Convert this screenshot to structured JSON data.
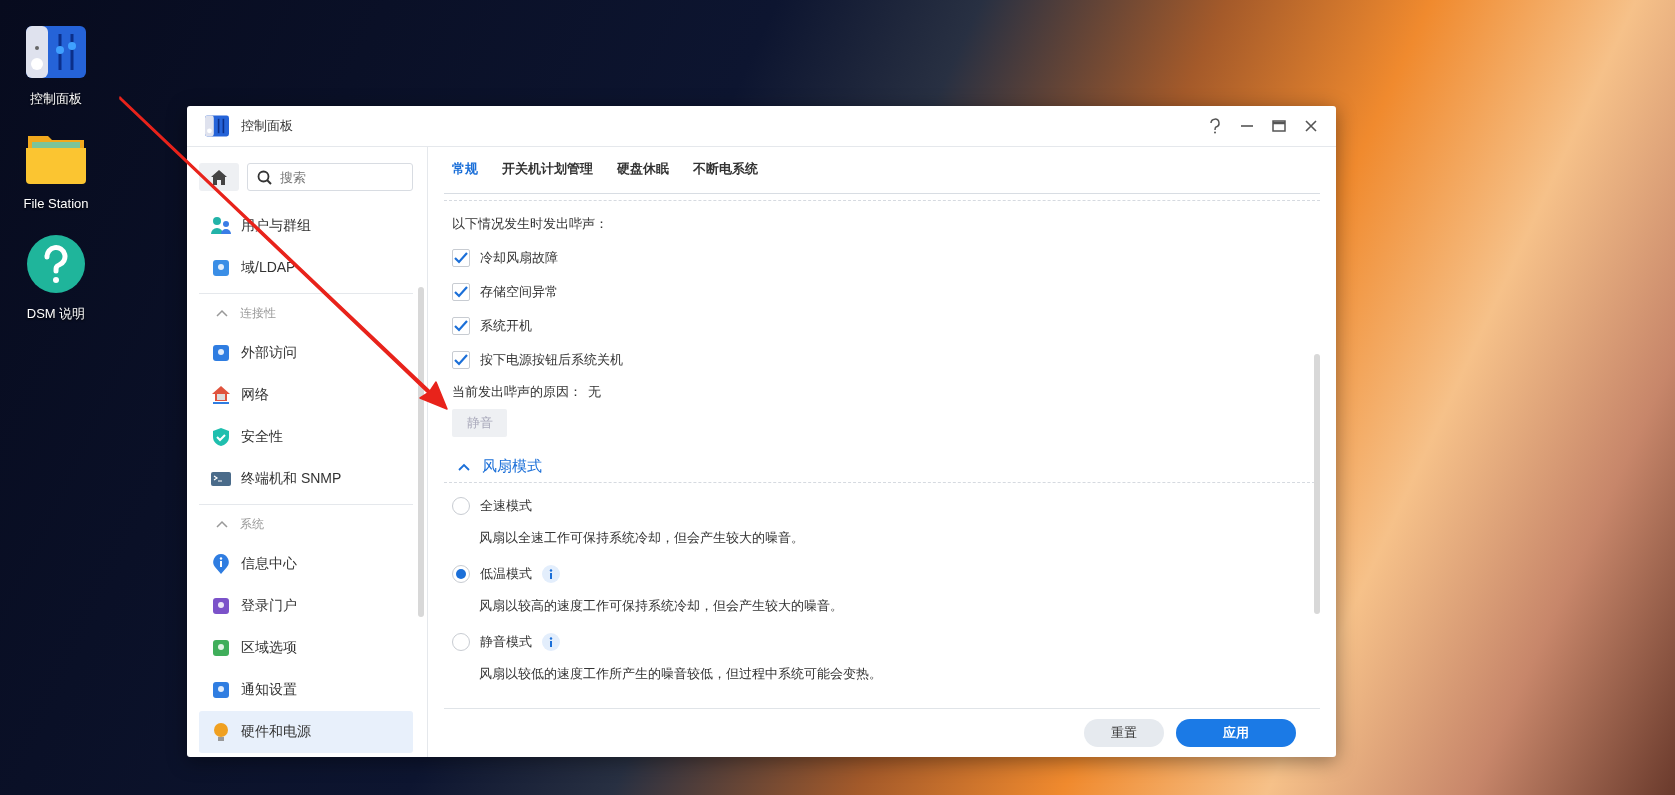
{
  "desktop_icons": [
    {
      "label": "控制面板",
      "kind": "control-panel"
    },
    {
      "label": "File Station",
      "kind": "folder"
    },
    {
      "label": "DSM 说明",
      "kind": "help"
    }
  ],
  "window": {
    "title": "控制面板"
  },
  "sidebar": {
    "search": {
      "placeholder": "搜索"
    },
    "groups": [
      {
        "items": [
          {
            "label": "用户与群组",
            "selected": false
          },
          {
            "label": "域/LDAP",
            "selected": false
          }
        ]
      },
      {
        "title": "连接性",
        "expanded": true,
        "items": [
          {
            "label": "外部访问",
            "selected": false
          },
          {
            "label": "网络",
            "selected": false
          },
          {
            "label": "安全性",
            "selected": false
          },
          {
            "label": "终端机和 SNMP",
            "selected": false
          }
        ]
      },
      {
        "title": "系统",
        "expanded": true,
        "items": [
          {
            "label": "信息中心",
            "selected": false
          },
          {
            "label": "登录门户",
            "selected": false
          },
          {
            "label": "区域选项",
            "selected": false
          },
          {
            "label": "通知设置",
            "selected": false
          },
          {
            "label": "硬件和电源",
            "selected": true
          }
        ]
      }
    ]
  },
  "tabs": [
    {
      "label": "常规",
      "selected": true
    },
    {
      "label": "开关机计划管理",
      "selected": false
    },
    {
      "label": "硬盘休眠",
      "selected": false
    },
    {
      "label": "不断电系统",
      "selected": false
    }
  ],
  "beep": {
    "heading": "以下情况发生时发出哔声：",
    "options": [
      {
        "label": "冷却风扇故障",
        "checked": true
      },
      {
        "label": "存储空间异常",
        "checked": true
      },
      {
        "label": "系统开机",
        "checked": true
      },
      {
        "label": "按下电源按钮后系统关机",
        "checked": true
      }
    ],
    "reason_label": "当前发出哔声的原因：",
    "reason_value": "无",
    "mute_button": {
      "label": "静音",
      "disabled": true
    }
  },
  "fan_mode": {
    "title": "风扇模式",
    "expanded": true,
    "modes": [
      {
        "label": "全速模式",
        "selected": false,
        "info": false,
        "description": "风扇以全速工作可保持系统冷却，但会产生较大的噪音。"
      },
      {
        "label": "低温模式",
        "selected": true,
        "info": true,
        "description": "风扇以较高的速度工作可保持系统冷却，但会产生较大的噪音。"
      },
      {
        "label": "静音模式",
        "selected": false,
        "info": true,
        "description": "风扇以较低的速度工作所产生的噪音较低，但过程中系统可能会变热。"
      }
    ]
  },
  "footer": {
    "reset": "重置",
    "apply": "应用"
  }
}
